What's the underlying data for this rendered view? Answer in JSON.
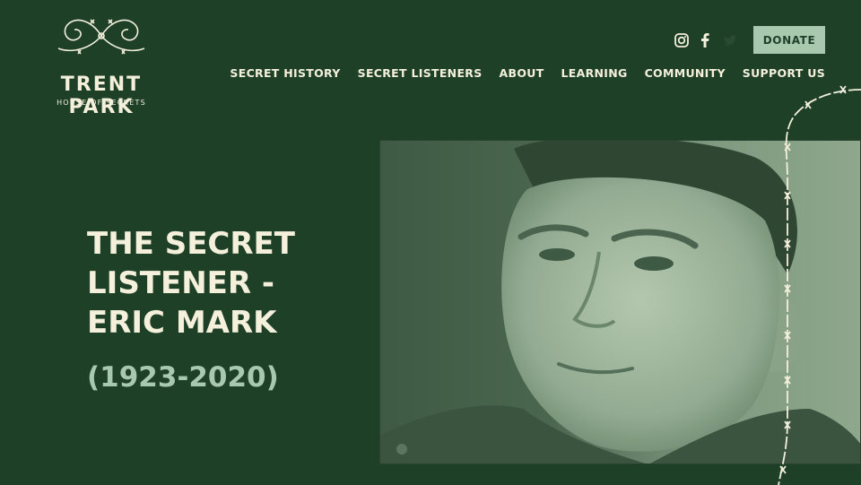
{
  "logo": {
    "title": "TRENT PARK",
    "subtitle": "HOUSE OF SECRETS",
    "icon": "barbed-wire-ornament-icon"
  },
  "header": {
    "social": [
      "instagram-icon",
      "facebook-icon",
      "twitter-icon"
    ],
    "donate_label": "DONATE"
  },
  "nav": {
    "items": [
      {
        "label": "SECRET HISTORY"
      },
      {
        "label": "SECRET LISTENERS"
      },
      {
        "label": "ABOUT"
      },
      {
        "label": "LEARNING"
      },
      {
        "label": "COMMUNITY"
      },
      {
        "label": "SUPPORT US"
      }
    ]
  },
  "hero": {
    "title": "THE SECRET LISTENER - ERIC MARK",
    "dates": "(1923-2020)",
    "photo_description": "portrait-photo"
  },
  "colors": {
    "background": "#1d4027",
    "text": "#f4f0dc",
    "accent": "#a9c9ae"
  }
}
